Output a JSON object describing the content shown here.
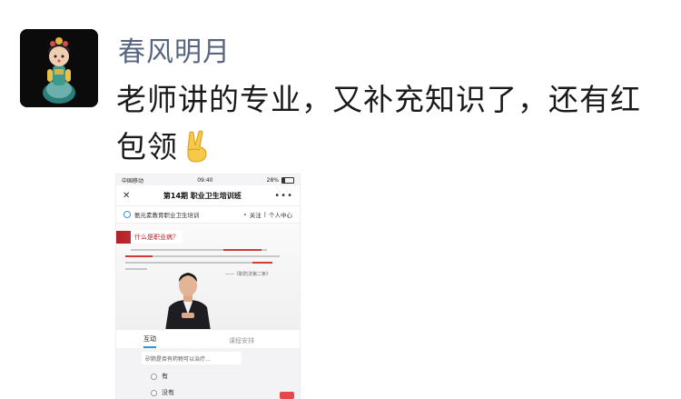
{
  "message": {
    "sender": "春风明月",
    "text": "老师讲的专业，又补充知识了，还有红包领",
    "emoji": "victory-hand-icon"
  },
  "phone": {
    "status": {
      "carrier": "中国移动",
      "time": "09:40",
      "battery": "28%"
    },
    "nav": {
      "title": "第14期 职业卫生培训班"
    },
    "account": {
      "name": "氨元素教育职业卫生培训",
      "follow": "关注",
      "separator": "|",
      "center": "个人中心"
    },
    "slide": {
      "question": "什么是职业病？",
      "citation": "——《职防法第二条》"
    },
    "tabs": {
      "interact": "互动",
      "schedule": "课程安排"
    },
    "quiz": {
      "question": "矽肺是否有药物可以治疗…",
      "options": [
        "有",
        "没有"
      ]
    }
  }
}
